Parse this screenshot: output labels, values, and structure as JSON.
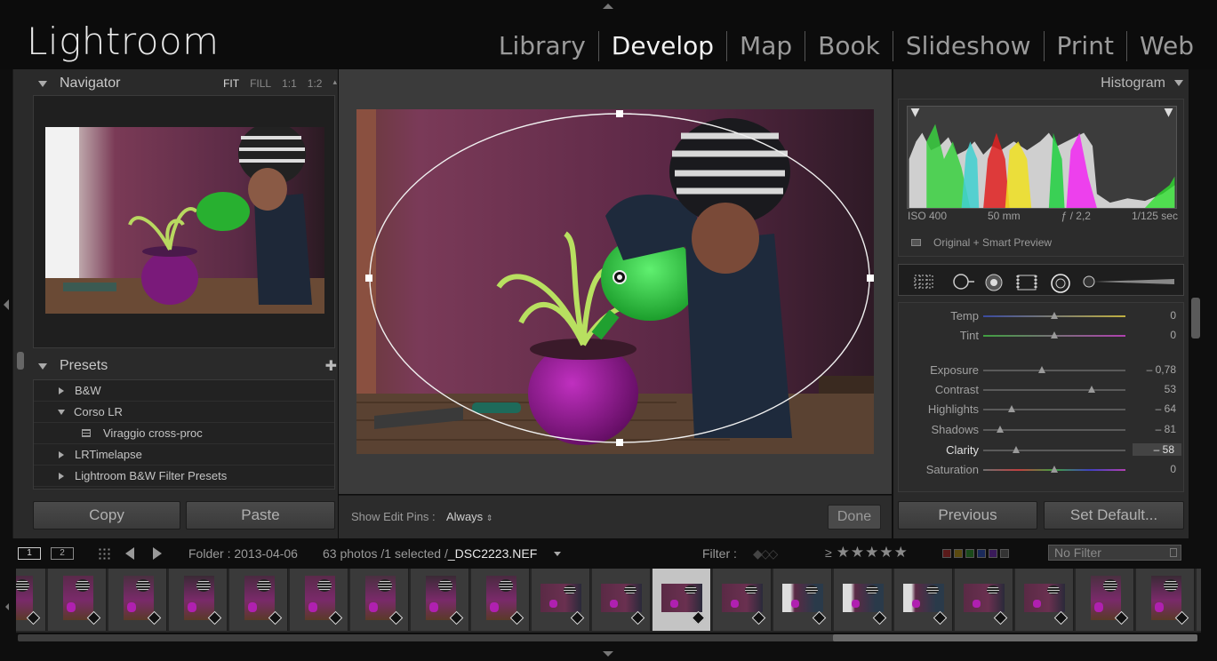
{
  "app": {
    "logo": "Lightroom"
  },
  "modules": [
    "Library",
    "Develop",
    "Map",
    "Book",
    "Slideshow",
    "Print",
    "Web"
  ],
  "active_module": "Develop",
  "navigator": {
    "title": "Navigator",
    "zoom": [
      "FIT",
      "FILL",
      "1:1",
      "1:2"
    ],
    "zoom_active": "FIT"
  },
  "presets": {
    "title": "Presets",
    "add_icon": "plus-icon",
    "items": [
      {
        "label": "B&W",
        "expanded": false
      },
      {
        "label": "Corso LR",
        "expanded": true
      },
      {
        "label": "Viraggio cross-proc",
        "child": true
      },
      {
        "label": "LRTimelapse",
        "expanded": false
      },
      {
        "label": "Lightroom B&W Filter Presets",
        "expanded": false
      }
    ]
  },
  "left_buttons": {
    "copy": "Copy",
    "paste": "Paste"
  },
  "toolbar": {
    "show_edit_pins_label": "Show Edit Pins :",
    "show_edit_pins_value": "Always",
    "done": "Done"
  },
  "histogram": {
    "title": "Histogram",
    "iso": "ISO 400",
    "focal": "50 mm",
    "aperture": "ƒ / 2,2",
    "shutter": "1/125 sec",
    "preview_status": "Original + Smart Preview"
  },
  "tools": [
    "crop-overlay-icon",
    "spot-removal-icon",
    "red-eye-icon",
    "graduated-filter-icon",
    "radial-filter-icon",
    "adjustment-brush-icon"
  ],
  "sliders": [
    {
      "label": "Temp",
      "value": "0",
      "pos": 0.5,
      "track": "temp"
    },
    {
      "label": "Tint",
      "value": "0",
      "pos": 0.5,
      "track": "tint"
    },
    {
      "label": "Exposure",
      "value": "– 0,78",
      "pos": 0.41,
      "track": "gray"
    },
    {
      "label": "Contrast",
      "value": "53",
      "pos": 0.76,
      "track": "gray"
    },
    {
      "label": "Highlights",
      "value": "– 64",
      "pos": 0.2,
      "track": "gray"
    },
    {
      "label": "Shadows",
      "value": "– 81",
      "pos": 0.12,
      "track": "gray"
    },
    {
      "label": "Clarity",
      "value": "– 58",
      "pos": 0.23,
      "track": "gray",
      "active": true
    },
    {
      "label": "Saturation",
      "value": "0",
      "pos": 0.5,
      "track": "sat"
    }
  ],
  "right_buttons": {
    "previous": "Previous",
    "set_default": "Set Default..."
  },
  "filmbar": {
    "monitor1": "1",
    "monitor2": "2",
    "folder": "Folder : 2013-04-06",
    "count": "63 photos /1 selected /",
    "filename": "_DSC2223.NEF",
    "filter_label": "Filter :",
    "rating_op": "≥",
    "stars": "★★★★★",
    "filter_value": "No Filter"
  },
  "colors": {
    "accent": "#f2f2f2",
    "panel": "#2a2a2a",
    "center": "#3b3b3b"
  }
}
